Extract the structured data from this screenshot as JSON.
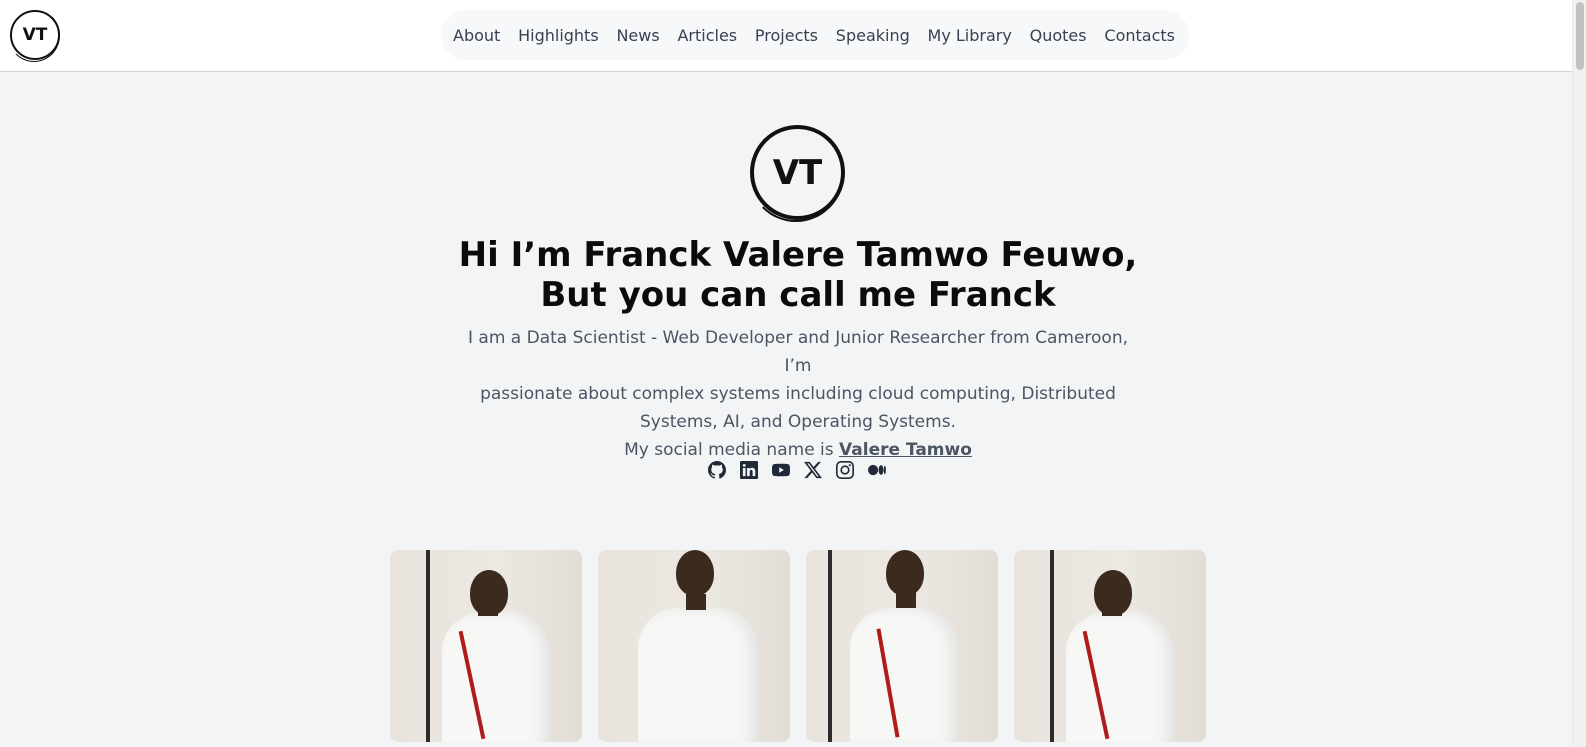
{
  "logo": {
    "text": "VT"
  },
  "nav": {
    "items": [
      "About",
      "Highlights",
      "News",
      "Articles",
      "Projects",
      "Speaking",
      "My Library",
      "Quotes",
      "Contacts"
    ]
  },
  "hero": {
    "logo_text": "VT",
    "title_line1": "Hi I’m Franck Valere Tamwo Feuwo,",
    "title_line2": "But you can call me Franck",
    "bio_line1": "I am a Data Scientist - Web Developer and Junior Researcher from Cameroon, I’m",
    "bio_line2": "passionate about complex systems including cloud computing, Distributed",
    "bio_line3": "Systems, AI, and Operating Systems.",
    "social_prefix": "My social media name is ",
    "social_name": "Valere Tamwo"
  },
  "socials": [
    "github-icon",
    "linkedin-icon",
    "youtube-icon",
    "x-icon",
    "instagram-icon",
    "medium-icon"
  ],
  "photos": 4,
  "colors": {
    "background": "#f3f4f6",
    "text": "#1f2937",
    "muted": "#4b5563",
    "heading": "#0b0b0b"
  }
}
